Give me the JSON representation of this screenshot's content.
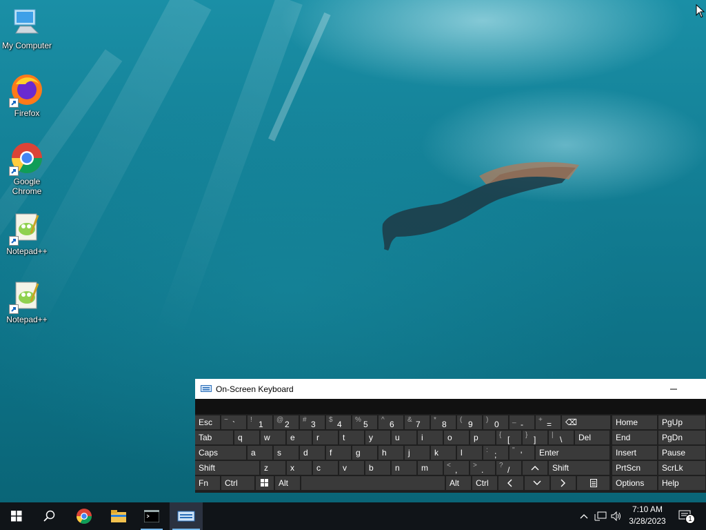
{
  "desktop": {
    "icons": [
      {
        "label": "My Computer",
        "icon": "computer-icon"
      },
      {
        "label": "Firefox",
        "icon": "firefox-icon"
      },
      {
        "label": "Google Chrome",
        "icon": "chrome-icon"
      },
      {
        "label": "Notepad++",
        "icon": "notepadpp-icon"
      },
      {
        "label": "Notepad++",
        "icon": "notepadpp-icon"
      }
    ]
  },
  "osk": {
    "title": "On-Screen Keyboard",
    "rows": {
      "r1": [
        {
          "label": "Esc"
        },
        {
          "sub": "~",
          "main": "`"
        },
        {
          "sub": "!",
          "main": "1"
        },
        {
          "sub": "@",
          "main": "2"
        },
        {
          "sub": "#",
          "main": "3"
        },
        {
          "sub": "$",
          "main": "4"
        },
        {
          "sub": "%",
          "main": "5"
        },
        {
          "sub": "^",
          "main": "6"
        },
        {
          "sub": "&",
          "main": "7"
        },
        {
          "sub": "*",
          "main": "8"
        },
        {
          "sub": "(",
          "main": "9"
        },
        {
          "sub": ")",
          "main": "0"
        },
        {
          "sub": "_",
          "main": "-"
        },
        {
          "sub": "+",
          "main": "="
        },
        {
          "label": "⌫"
        },
        {
          "label": "Home"
        },
        {
          "label": "PgUp"
        }
      ],
      "r2": [
        "Tab",
        "q",
        "w",
        "e",
        "r",
        "t",
        "y",
        "u",
        "i",
        "o",
        "p"
      ],
      "r2b": [
        {
          "sub": "{",
          "main": "["
        },
        {
          "sub": "}",
          "main": "]"
        },
        {
          "sub": "|",
          "main": "\\"
        }
      ],
      "r2c": [
        "Del",
        "End",
        "PgDn"
      ],
      "r3": [
        "Caps",
        "a",
        "s",
        "d",
        "f",
        "g",
        "h",
        "j",
        "k",
        "l"
      ],
      "r3b": [
        {
          "sub": ":",
          "main": ";"
        },
        {
          "sub": "\"",
          "main": "'"
        }
      ],
      "r3c": [
        "Enter",
        "Insert",
        "Pause"
      ],
      "r4": [
        "Shift",
        "z",
        "x",
        "c",
        "v",
        "b",
        "n",
        "m"
      ],
      "r4b": [
        {
          "sub": "<",
          "main": ","
        },
        {
          "sub": ">",
          "main": "."
        },
        {
          "sub": "?",
          "main": "/"
        }
      ],
      "r4c": [
        "Shift",
        "PrtScn",
        "ScrLk"
      ],
      "r5": [
        "Fn",
        "Ctrl",
        "Alt",
        "Alt",
        "Ctrl",
        "Options",
        "Help"
      ]
    }
  },
  "taskbar": {
    "clock_time": "7:10 AM",
    "clock_date": "3/28/2023",
    "notification_count": "1"
  }
}
